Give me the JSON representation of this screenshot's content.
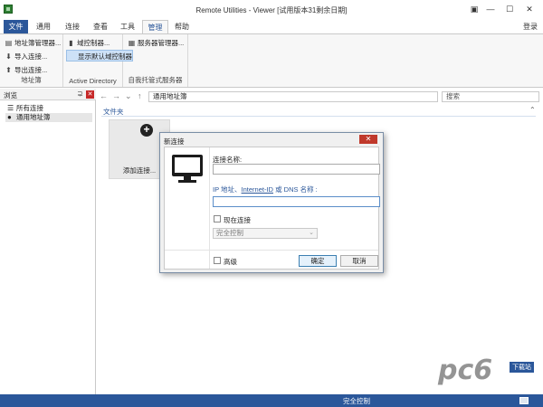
{
  "window": {
    "title": "Remote Utilities - Viewer [试用版本31剩余日期]",
    "controls": [
      "▣",
      "—",
      "☐",
      "✕"
    ]
  },
  "tabs": [
    {
      "label": "文件"
    },
    {
      "label": "通用"
    },
    {
      "label": "连接"
    },
    {
      "label": "查看"
    },
    {
      "label": "工具"
    },
    {
      "label": "管理"
    },
    {
      "label": "帮助"
    }
  ],
  "login_label": "登录",
  "ribbon": {
    "group1": {
      "items": [
        "地址簿管理器...",
        "导入连接...",
        "导出连接..."
      ],
      "label": "地址簿"
    },
    "group2": {
      "items": [
        "域控制器...",
        "显示默认域控制器"
      ],
      "label": "Active Directory"
    },
    "group3": {
      "items": [
        "服务器管理器..."
      ],
      "label": "自我托管式服务器"
    }
  },
  "left_panel": {
    "title": "浏览",
    "pin": "⊋",
    "close": "✕",
    "items": [
      "所有连接",
      "通用地址簿"
    ]
  },
  "nav": {
    "back": "←",
    "forward": "→",
    "dropdown": "⌄",
    "up": "↑",
    "address": "通用地址簿",
    "search_placeholder": "搜索"
  },
  "content": {
    "section_title": "文件夹",
    "tile_label": "添加连接..."
  },
  "dialog": {
    "title": "新连接",
    "name_label": "连接名称:",
    "name_value": "",
    "ip_label_a": "IP 地址、",
    "ip_label_link": "Internet-ID",
    "ip_label_b": " 或 DNS 名称 :",
    "ip_value": "",
    "connect_now": "现在连接",
    "mode": "完全控制",
    "advanced": "高级",
    "ok": "确定",
    "cancel": "取消"
  },
  "statusbar": {
    "text": "完全控制"
  },
  "watermark": {
    "text": "pc6",
    "sub": "下载站"
  }
}
